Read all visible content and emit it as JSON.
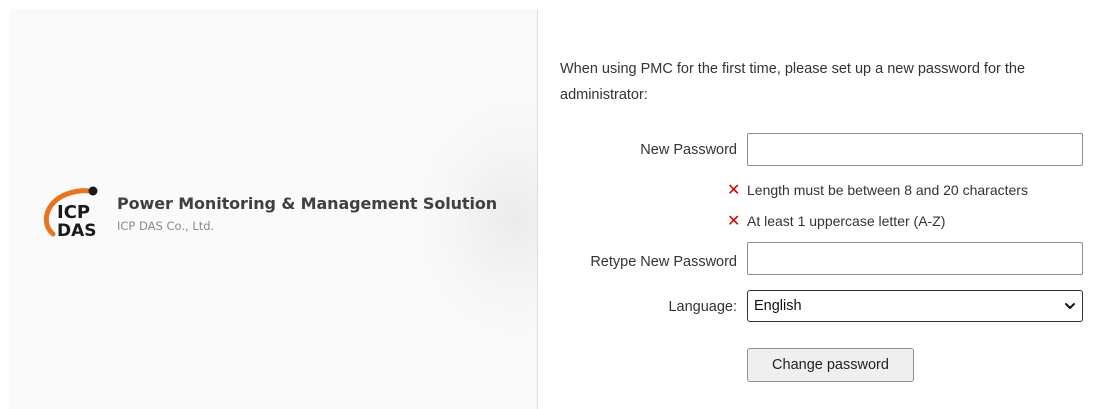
{
  "brand": {
    "logo_line1": "ICP",
    "logo_line2": "DAS",
    "title": "Power Monitoring & Management Solution",
    "company": "ICP DAS Co., Ltd."
  },
  "form": {
    "intro": "When using PMC for the first time, please set up a new password for the administrator:",
    "new_password_label": "New Password",
    "new_password_value": "",
    "rules": [
      {
        "icon": "x-mark-icon",
        "text": "Length must be between 8 and 20 characters"
      },
      {
        "icon": "x-mark-icon",
        "text": "At least 1 uppercase letter (A-Z)"
      }
    ],
    "retype_label": "Retype New Password",
    "retype_value": "",
    "language_label": "Language:",
    "language_selected": "English",
    "submit_label": "Change password"
  },
  "colors": {
    "error": "#d50000",
    "logo_orange": "#e8741e",
    "logo_dark": "#1a1a1a"
  }
}
